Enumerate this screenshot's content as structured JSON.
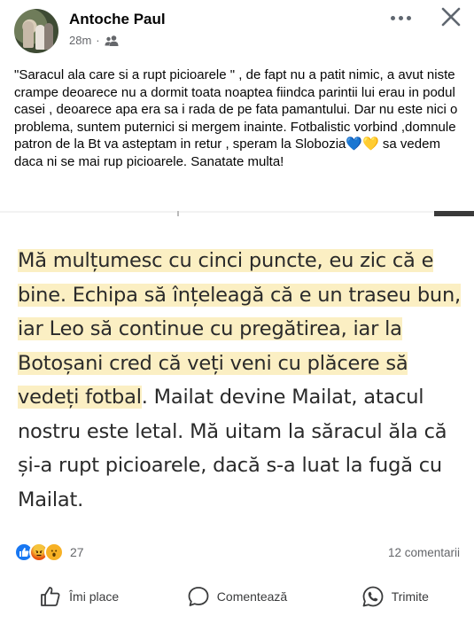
{
  "post": {
    "author": "Antoche Paul",
    "time": "28m",
    "audience_icon": "friends-icon",
    "text": "\"Saracul ala care si a rupt picioarele \" , de fapt nu a patit nimic, a avut niste  crampe deoarece nu a dormit toata noaptea fiindca parintii lui erau in podul casei , deoarece apa era sa i rada de pe fata pamantului. Dar nu este nici o problema, suntem puternici si mergem inainte. Fotbalistic vorbind ,domnule patron de la Bt  va asteptam in retur , speram la Slobozia",
    "text_emojis": "💙💛",
    "text_end": " sa vedem daca ni se mai rup picioarele. Sanatate multa!"
  },
  "quote": {
    "highlighted": "Mă mulțumesc cu cinci puncte, eu zic că e bine. Echipa să înțeleagă că e un traseu bun, iar Leo să continue cu pregătirea, iar la Botoșani cred că veți veni cu plăcere să vedeți fotbal",
    "rest": ". Mailat devine Mailat, atacul nostru este letal. Mă uitam la săracul ăla că și-a rupt picioarele, dacă s-a luat la fugă cu Mailat."
  },
  "stats": {
    "reactions_count": "27",
    "comments_count": "12 comentarii",
    "reaction_icons": [
      "like-icon",
      "angry-icon",
      "wow-icon"
    ]
  },
  "actions": {
    "like": "Îmi place",
    "comment": "Comentează",
    "share": "Trimite"
  },
  "colors": {
    "highlight": "#fbefc3",
    "like_blue": "#1877f2",
    "secondary_text": "#65676b"
  }
}
